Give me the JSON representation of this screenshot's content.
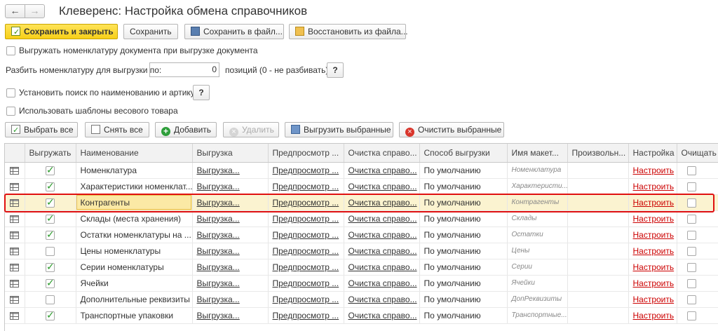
{
  "window": {
    "title": "Клеверенс: Настройка обмена справочников",
    "back_glyph": "←",
    "forward_glyph": "→"
  },
  "toolbar": {
    "save_close": "Сохранить и закрыть",
    "save": "Сохранить",
    "save_file": "Сохранить в файл...",
    "restore_file": "Восстановить из файла..."
  },
  "options": {
    "export_nomenclature_label": "Выгружать номенклатуру документа при выгрузке документа",
    "split_label": "Разбить номенклатуру для выгрузки по:",
    "split_value": "0",
    "split_suffix": "позиций (0 - не разбивать)",
    "help_glyph": "?",
    "search_label": "Установить поиск по наименованию и артикулу",
    "weight_label": "Использовать шаблоны весового товара"
  },
  "grid_toolbar": {
    "select_all": "Выбрать все",
    "deselect_all": "Снять все",
    "add": "Добавить",
    "delete": "Удалить",
    "export_selected": "Выгрузить выбранные",
    "clear_selected": "Очистить выбранные"
  },
  "grid": {
    "headers": [
      "",
      "Выгружать",
      "Наименование",
      "Выгрузка",
      "Предпросмотр ...",
      "Очистка справо...",
      "Способ выгрузки",
      "Имя макет...",
      "Произвольн...",
      "Настройка",
      "Очищать"
    ],
    "rows": [
      {
        "export": true,
        "name": "Номенклатура",
        "upload": "Выгрузка...",
        "preview": "Предпросмотр ...",
        "clear": "Очистка справо...",
        "method": "По умолчанию",
        "layout": "Номенклатура",
        "custom": "",
        "setup": "Настроить",
        "clearflag": false
      },
      {
        "export": true,
        "name": "Характеристики номенклат...",
        "upload": "Выгрузка...",
        "preview": "Предпросмотр ...",
        "clear": "Очистка справо...",
        "method": "По умолчанию",
        "layout": "Характеристи...",
        "custom": "",
        "setup": "Настроить",
        "clearflag": false
      },
      {
        "export": true,
        "name": "Контрагенты",
        "upload": "Выгрузка...",
        "preview": "Предпросмотр ...",
        "clear": "Очистка справо...",
        "method": "По умолчанию",
        "layout": "Контрагенты",
        "custom": "",
        "setup": "Настроить",
        "clearflag": false
      },
      {
        "export": true,
        "name": "Склады (места хранения)",
        "upload": "Выгрузка...",
        "preview": "Предпросмотр ...",
        "clear": "Очистка справо...",
        "method": "По умолчанию",
        "layout": "Склады",
        "custom": "",
        "setup": "Настроить",
        "clearflag": false
      },
      {
        "export": true,
        "name": "Остатки номенклатуры на ...",
        "upload": "Выгрузка...",
        "preview": "Предпросмотр ...",
        "clear": "Очистка справо...",
        "method": "По умолчанию",
        "layout": "Остатки",
        "custom": "",
        "setup": "Настроить",
        "clearflag": false
      },
      {
        "export": false,
        "name": "Цены номенклатуры",
        "upload": "Выгрузка...",
        "preview": "Предпросмотр ...",
        "clear": "Очистка справо...",
        "method": "По умолчанию",
        "layout": "Цены",
        "custom": "",
        "setup": "Настроить",
        "clearflag": false
      },
      {
        "export": true,
        "name": "Серии номенклатуры",
        "upload": "Выгрузка...",
        "preview": "Предпросмотр ...",
        "clear": "Очистка справо...",
        "method": "По умолчанию",
        "layout": "Серии",
        "custom": "",
        "setup": "Настроить",
        "clearflag": false
      },
      {
        "export": true,
        "name": "Ячейки",
        "upload": "Выгрузка...",
        "preview": "Предпросмотр ...",
        "clear": "Очистка справо...",
        "method": "По умолчанию",
        "layout": "Ячейки",
        "custom": "",
        "setup": "Настроить",
        "clearflag": false
      },
      {
        "export": false,
        "name": "Дополнительные реквизиты",
        "upload": "Выгрузка...",
        "preview": "Предпросмотр ...",
        "clear": "Очистка справо...",
        "method": "По умолчанию",
        "layout": "ДопРеквизиты",
        "custom": "",
        "setup": "Настроить",
        "clearflag": false
      },
      {
        "export": true,
        "name": "Транспортные упаковки",
        "upload": "Выгрузка...",
        "preview": "Предпросмотр ...",
        "clear": "Очистка справо...",
        "method": "По умолчанию",
        "layout": "Транспортные...",
        "custom": "",
        "setup": "Настроить",
        "clearflag": false
      }
    ],
    "selected_row": 2
  },
  "colors": {
    "primary_button": "#f7cf18",
    "selected_row": "#fbf3d0",
    "highlight_border": "#e01010",
    "setup_link": "#cc0000"
  }
}
